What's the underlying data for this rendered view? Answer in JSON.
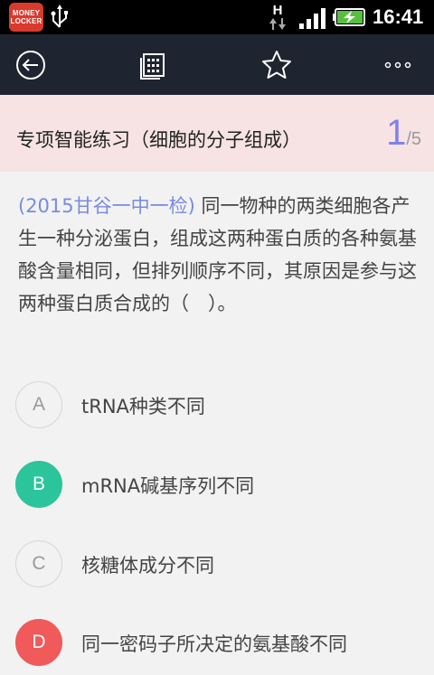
{
  "statusbar": {
    "app_icon_text": "MONEY LOCKER",
    "network_label": "H",
    "time": "16:41"
  },
  "toolbar": {
    "back_icon": "back-circle-icon",
    "sheet_icon": "answer-sheet-icon",
    "star_icon": "star-icon",
    "more_icon": "more-dots-icon"
  },
  "header": {
    "title": "专项智能练习（细胞的分子组成）",
    "current": "1",
    "separator": "/",
    "total": "5"
  },
  "question": {
    "source": "(2015甘谷一中一检)",
    "text": " 同一物种的两类细胞各产生一种分泌蛋白，组成这两种蛋白质的各种氨基酸含量相同，但排列顺序不同，其原因是参与这两种蛋白质合成的（　）。"
  },
  "options": [
    {
      "letter": "A",
      "text": "tRNA种类不同",
      "state": "normal"
    },
    {
      "letter": "B",
      "text": "mRNA碱基序列不同",
      "state": "correct"
    },
    {
      "letter": "C",
      "text": "核糖体成分不同",
      "state": "normal"
    },
    {
      "letter": "D",
      "text": "同一密码子所决定的氨基酸不同",
      "state": "wrong"
    }
  ],
  "colors": {
    "correct": "#2cc59b",
    "wrong": "#f05a5a",
    "accent": "#8080ee",
    "toolbar": "#1e2530",
    "header": "#f7e3e3"
  }
}
